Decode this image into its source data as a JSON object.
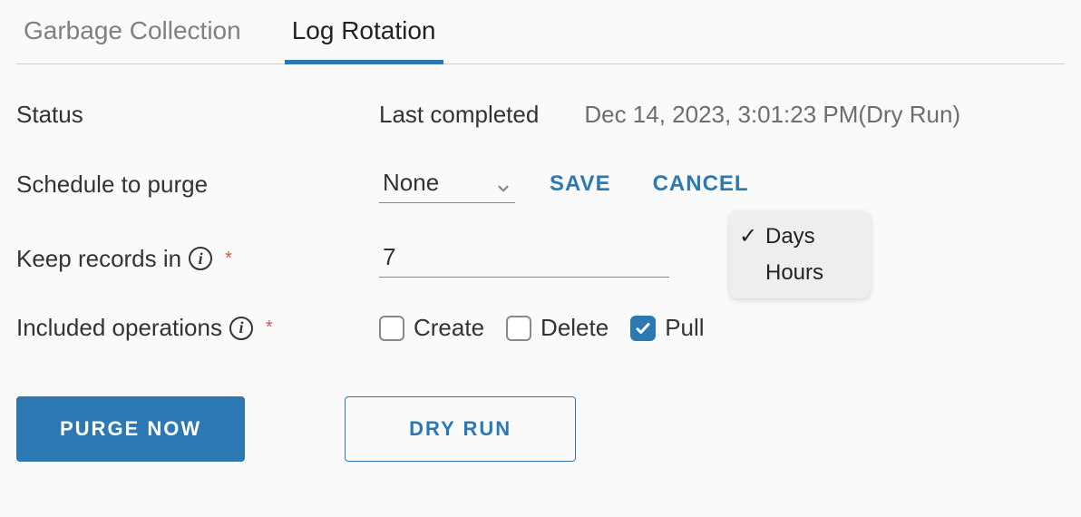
{
  "tabs": {
    "garbage_collection": "Garbage Collection",
    "log_rotation": "Log Rotation"
  },
  "status": {
    "label": "Status",
    "last_completed_label": "Last completed",
    "last_completed_value": "Dec 14, 2023, 3:01:23 PM(Dry Run)"
  },
  "schedule": {
    "label": "Schedule to purge",
    "selected": "None",
    "save_label": "SAVE",
    "cancel_label": "CANCEL"
  },
  "keep_records": {
    "label": "Keep records in",
    "value": "7",
    "unit_options": [
      "Days",
      "Hours"
    ],
    "unit_selected": "Days"
  },
  "included_ops": {
    "label": "Included operations",
    "options": {
      "create": {
        "label": "Create",
        "checked": false
      },
      "delete": {
        "label": "Delete",
        "checked": false
      },
      "pull": {
        "label": "Pull",
        "checked": true
      }
    }
  },
  "buttons": {
    "purge_now": "PURGE NOW",
    "dry_run": "DRY RUN"
  }
}
